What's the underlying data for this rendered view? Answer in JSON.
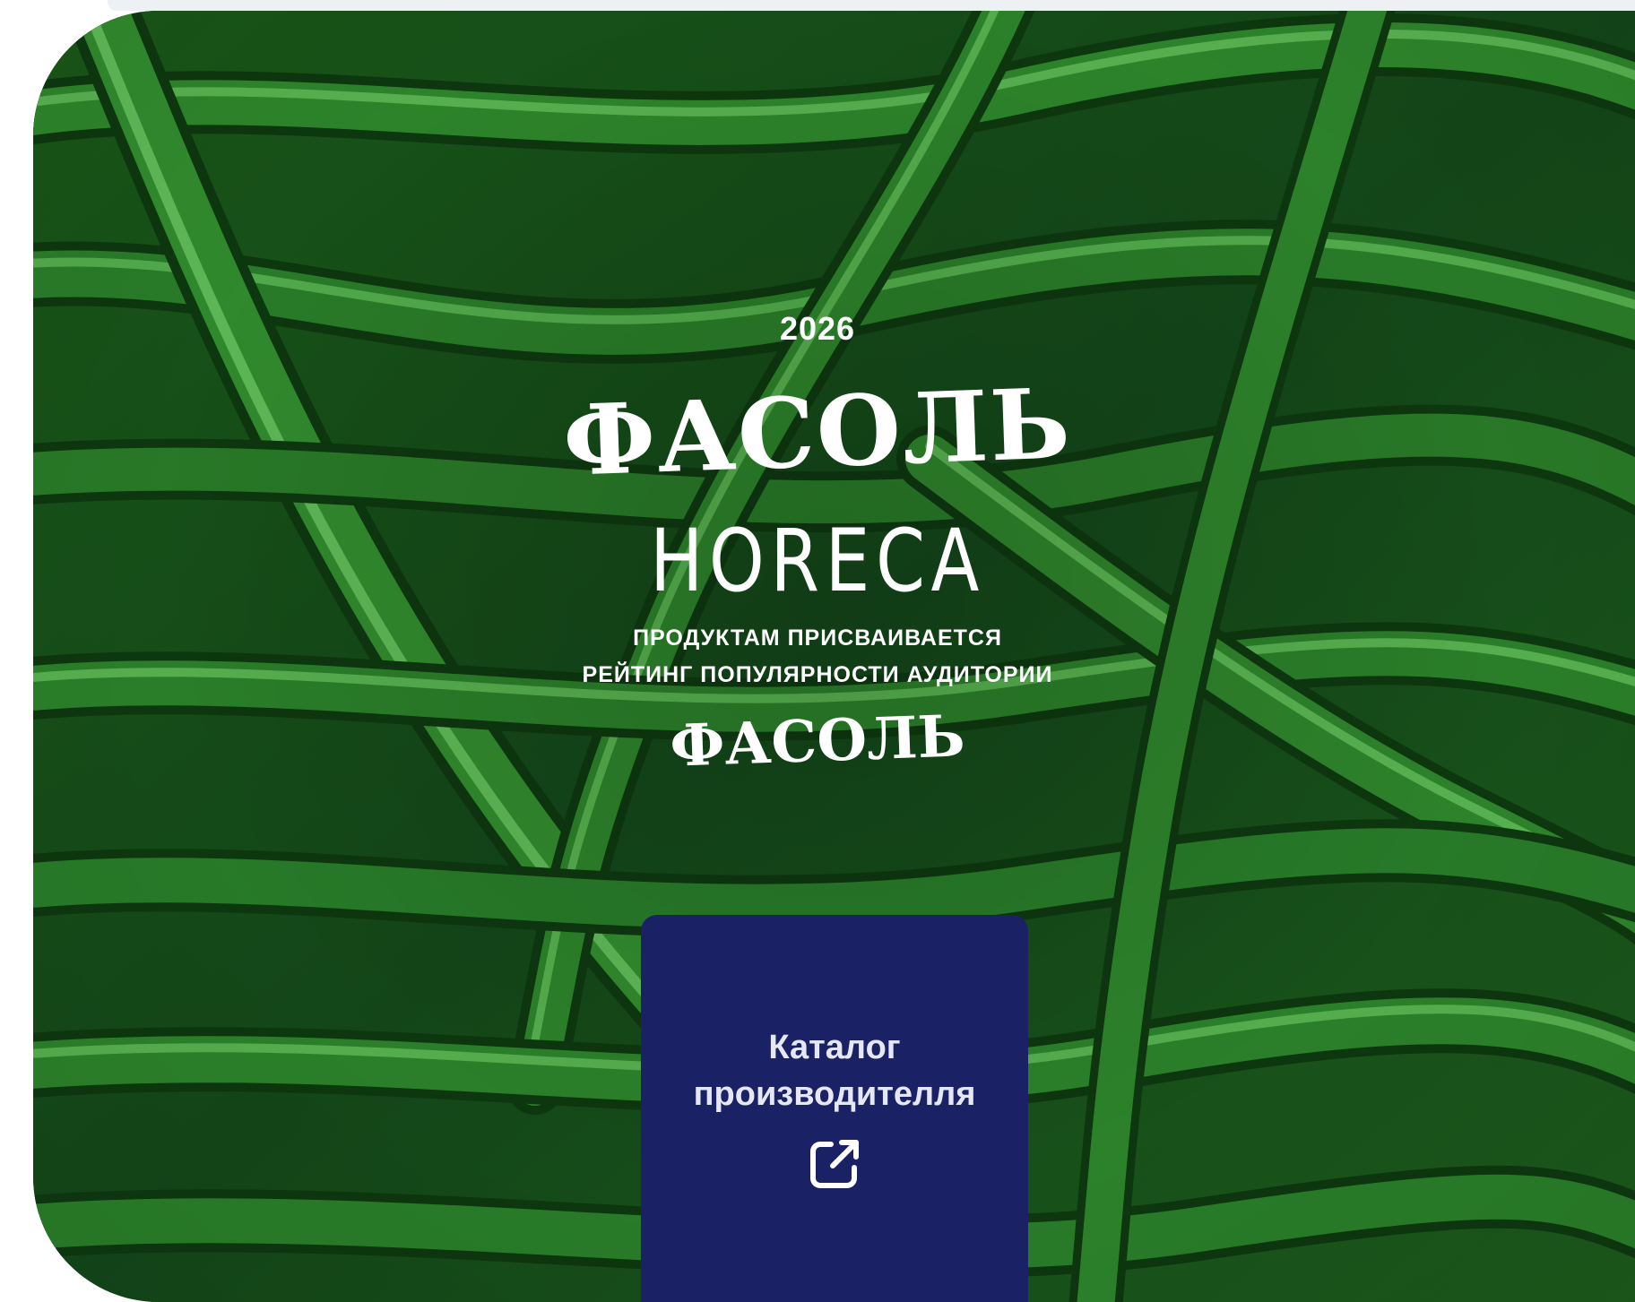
{
  "hero": {
    "year": "2026",
    "title": "ФАСОЛЬ",
    "category": "HORECA",
    "subtitle_line1": "ПРОДУКТАМ ПРИСВАИВАЕТСЯ",
    "subtitle_line2": "РЕЙТИНГ ПОПУЛЯРНОСТИ АУДИТОРИИ",
    "logo_text": "ФАСОЛЬ",
    "background": "green-beans-photo"
  },
  "catalog": {
    "label_line1": "Каталог",
    "label_line2": "производителля",
    "icon": "external-link-icon"
  },
  "colors": {
    "card": "#1a2164",
    "text": "#ffffff",
    "bean_dark": "#0f3d12",
    "bean_light": "#3f9a3a"
  }
}
